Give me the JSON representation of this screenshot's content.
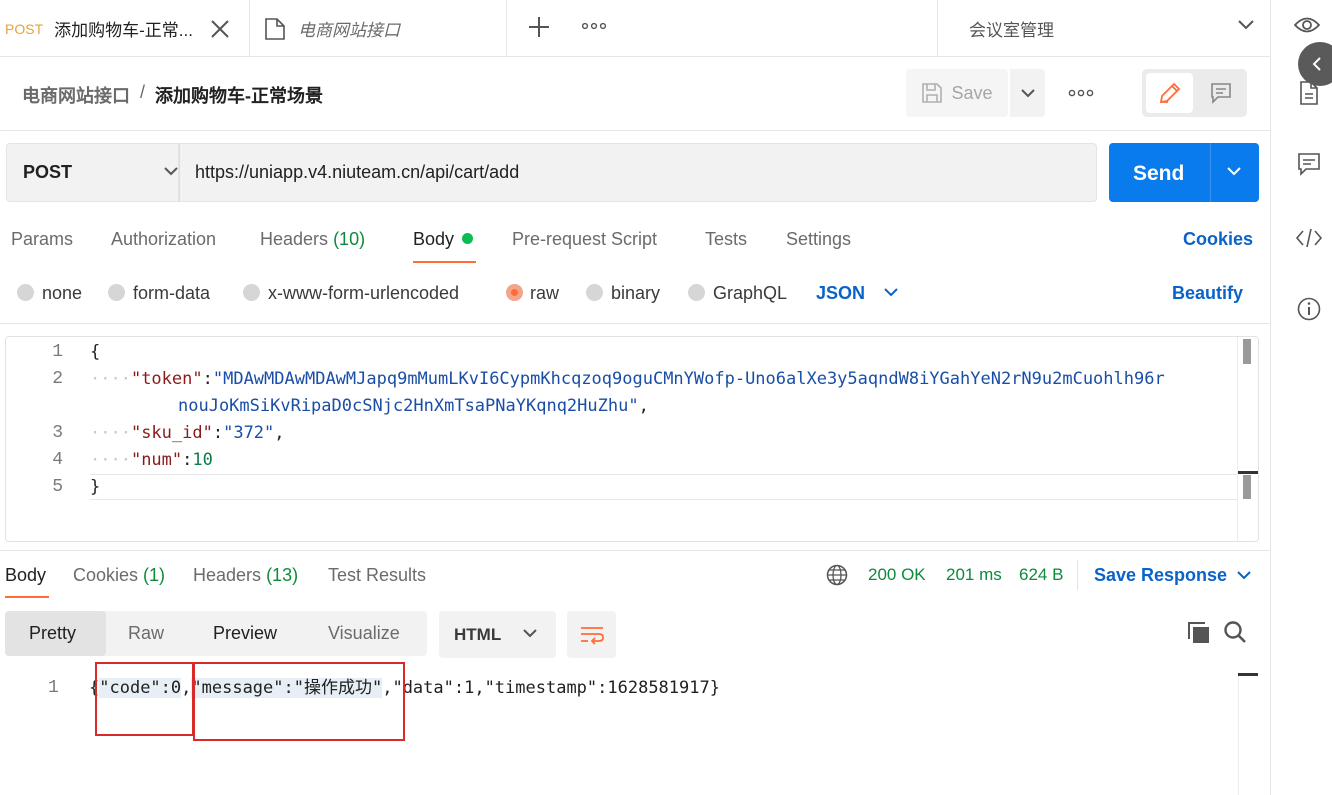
{
  "tabbar": {
    "active_tab_method": "POST",
    "active_tab_title": "添加购物车-正常...",
    "collection_tab_title": "电商网站接口",
    "workspace": "会议室管理"
  },
  "breadcrumb": {
    "collection": "电商网站接口",
    "separator": "/",
    "request": "添加购物车-正常场景"
  },
  "toolbar": {
    "save_label": "Save"
  },
  "request": {
    "method": "POST",
    "url": "https://uniapp.v4.niuteam.cn/api/cart/add",
    "send_label": "Send"
  },
  "request_tabs": {
    "params": "Params",
    "authorization": "Authorization",
    "headers": "Headers",
    "headers_count": "(10)",
    "body": "Body",
    "prerequest": "Pre-request Script",
    "tests": "Tests",
    "settings": "Settings",
    "cookies": "Cookies"
  },
  "body_types": {
    "none": "none",
    "form_data": "form-data",
    "urlencoded": "x-www-form-urlencoded",
    "raw": "raw",
    "binary": "binary",
    "graphql": "GraphQL",
    "language": "JSON",
    "beautify": "Beautify",
    "selected": "raw"
  },
  "editor": {
    "line_numbers": [
      "1",
      "2",
      "3",
      "4",
      "5"
    ],
    "open_brace": "{",
    "close_brace": "}",
    "indent": "····",
    "token_key": "\"token\"",
    "token_value_1": "\"MDAwMDAwMDAwMJapq9mMumLKvI6CypmKhcqzoq9oguCMnYWofp-Uno6alXe3y5aqndW8iYGahYeN2rN9u2mCuohlh96r",
    "token_value_2": "nouJoKmSiKvRipaD0cSNjc2HnXmTsaPNaYKqnq2HuZhu\"",
    "sku_key": "\"sku_id\"",
    "sku_value": "\"372\"",
    "num_key": "\"num\"",
    "num_value": "10",
    "colon": ":",
    "comma": ","
  },
  "response_tabs": {
    "body": "Body",
    "cookies": "Cookies",
    "cookies_count": "(1)",
    "headers": "Headers",
    "headers_count": "(13)",
    "test_results": "Test Results"
  },
  "response_status": {
    "status": "200 OK",
    "time": "201 ms",
    "size": "624 B",
    "save_response": "Save Response"
  },
  "response_view": {
    "pretty": "Pretty",
    "raw": "Raw",
    "preview": "Preview",
    "visualize": "Visualize",
    "format": "HTML"
  },
  "response_body": {
    "line_number": "1",
    "open": "{",
    "code_part": "\"code\":0",
    "comma": ",",
    "message_part": "\"message\":\"操作成功\"",
    "rest": ",\"data\":1,\"timestamp\":1628581917}"
  },
  "colors": {
    "accent": "#ff6c37",
    "send_blue": "#097bed",
    "link_blue": "#0a63c9",
    "status_green": "#0d8a3c",
    "annotation_red": "#d92a2a"
  }
}
